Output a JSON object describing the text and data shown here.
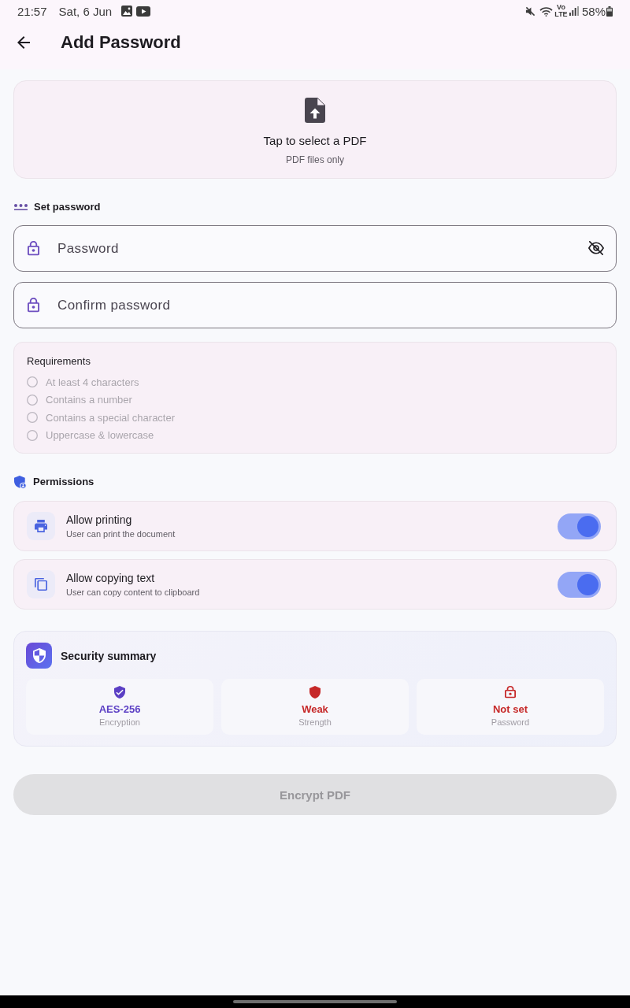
{
  "status_bar": {
    "time": "21:57",
    "date": "Sat, 6 Jun",
    "network": "Vo LTE",
    "battery": "58%"
  },
  "app_bar": {
    "title": "Add Password"
  },
  "upload": {
    "title": "Tap to select a PDF",
    "subtitle": "PDF files only"
  },
  "password_section": {
    "heading": "Set password",
    "fields": [
      {
        "placeholder": "Password",
        "visibility_toggle": true
      },
      {
        "placeholder": "Confirm password",
        "visibility_toggle": false
      }
    ]
  },
  "requirements": {
    "heading": "Requirements",
    "items": [
      {
        "label": "At least 4 characters",
        "met": false
      },
      {
        "label": "Contains a number",
        "met": false
      },
      {
        "label": "Contains a special character",
        "met": false
      },
      {
        "label": "Uppercase & lowercase",
        "met": false
      }
    ]
  },
  "permissions": {
    "heading": "Permissions",
    "items": [
      {
        "kind": "print",
        "title": "Allow printing",
        "description": "User can print the document",
        "on": true
      },
      {
        "kind": "copy",
        "title": "Allow copying text",
        "description": "User can copy content to clipboard",
        "on": true
      }
    ]
  },
  "security_summary": {
    "title": "Security summary",
    "stats": [
      {
        "kind": "encryption",
        "value": "AES-256",
        "label": "Encryption",
        "color": "#5b3fc4"
      },
      {
        "kind": "strength",
        "value": "Weak",
        "label": "Strength",
        "color": "#c62828"
      },
      {
        "kind": "password",
        "value": "Not set",
        "label": "Password",
        "color": "#c62828"
      }
    ]
  },
  "encrypt_button": {
    "label": "Encrypt PDF",
    "disabled": true
  }
}
